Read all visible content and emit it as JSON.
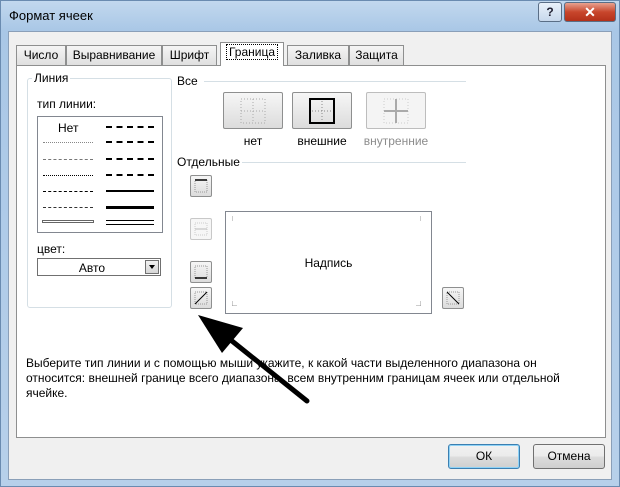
{
  "window": {
    "title": "Формат ячеек",
    "help_label": "?",
    "close_label": "✕"
  },
  "tabs": [
    {
      "label": "Число",
      "active": false
    },
    {
      "label": "Выравнивание",
      "active": false
    },
    {
      "label": "Шрифт",
      "active": false
    },
    {
      "label": "Граница",
      "active": true
    },
    {
      "label": "Заливка",
      "active": false
    },
    {
      "label": "Защита",
      "active": false
    }
  ],
  "line_group": {
    "title": "Линия",
    "style_label": "тип линии:",
    "none_label": "Нет",
    "color_label": "цвет:",
    "color_value": "Авто"
  },
  "presets": {
    "title": "Все",
    "items": [
      {
        "label": "нет",
        "icon": "border-none-icon",
        "enabled": true
      },
      {
        "label": "внешние",
        "icon": "border-outline-icon",
        "enabled": true
      },
      {
        "label": "внутренние",
        "icon": "border-inside-icon",
        "enabled": false
      }
    ]
  },
  "border": {
    "title": "Отдельные",
    "preview_text": "Надпись"
  },
  "description": "Выберите тип линии и с помощью мыши укажите, к какой части выделенного диапазона он относится: внешней границе всего диапазона, всем внутренним границам ячеек или отдельной ячейке.",
  "buttons": {
    "ok": "ОК",
    "cancel": "Отмена"
  },
  "colors": {
    "arrow": "#000000",
    "close": "#c8462c",
    "frame": "#b7d0ea"
  }
}
